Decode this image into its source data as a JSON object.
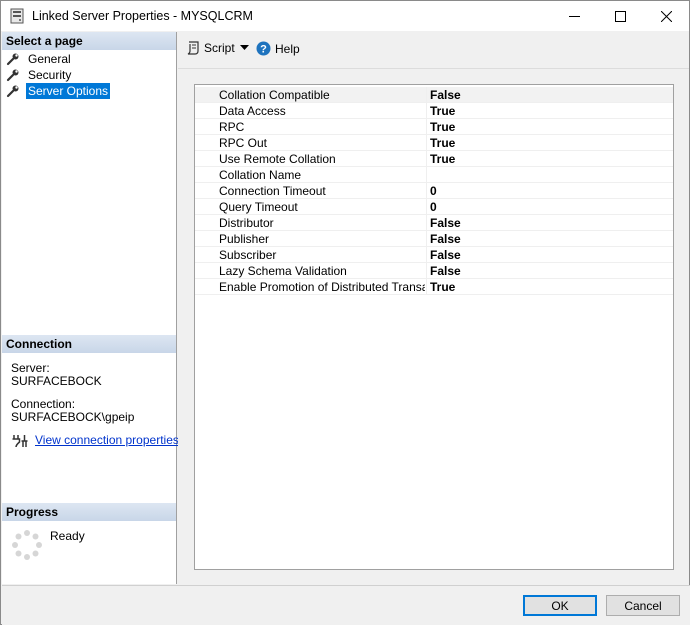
{
  "window": {
    "title": "Linked Server Properties - MYSQLCRM"
  },
  "sidebar": {
    "header": "Select a page",
    "items": [
      {
        "label": "General"
      },
      {
        "label": "Security"
      },
      {
        "label": "Server Options"
      }
    ],
    "selected_index": 2
  },
  "connection": {
    "header": "Connection",
    "server_label": "Server:",
    "server_value": "SURFACEBOCK",
    "connection_label": "Connection:",
    "connection_value": "SURFACEBOCK\\gpeip",
    "view_properties_link": "View connection properties"
  },
  "progress": {
    "header": "Progress",
    "status": "Ready"
  },
  "toolbar": {
    "script_label": "Script",
    "help_label": "Help"
  },
  "options": [
    {
      "name": "Collation Compatible",
      "value": "False"
    },
    {
      "name": "Data Access",
      "value": "True"
    },
    {
      "name": "RPC",
      "value": "True"
    },
    {
      "name": "RPC Out",
      "value": "True"
    },
    {
      "name": "Use Remote Collation",
      "value": "True"
    },
    {
      "name": "Collation Name",
      "value": ""
    },
    {
      "name": "Connection Timeout",
      "value": "0"
    },
    {
      "name": "Query Timeout",
      "value": "0"
    },
    {
      "name": "Distributor",
      "value": "False"
    },
    {
      "name": "Publisher",
      "value": "False"
    },
    {
      "name": "Subscriber",
      "value": "False"
    },
    {
      "name": "Lazy Schema Validation",
      "value": "False"
    },
    {
      "name": "Enable Promotion of Distributed Transactio",
      "value": "True"
    }
  ],
  "buttons": {
    "ok": "OK",
    "cancel": "Cancel"
  },
  "colors": {
    "selection": "#0078d7",
    "link": "#0033cc",
    "help_icon": "#1e73be"
  },
  "icons": {
    "app": "server-icon",
    "nav": "wrench-icon",
    "script": "script-icon",
    "help": "help-icon",
    "connection": "connection-plug-icon",
    "progress": "progress-spinner-icon"
  }
}
